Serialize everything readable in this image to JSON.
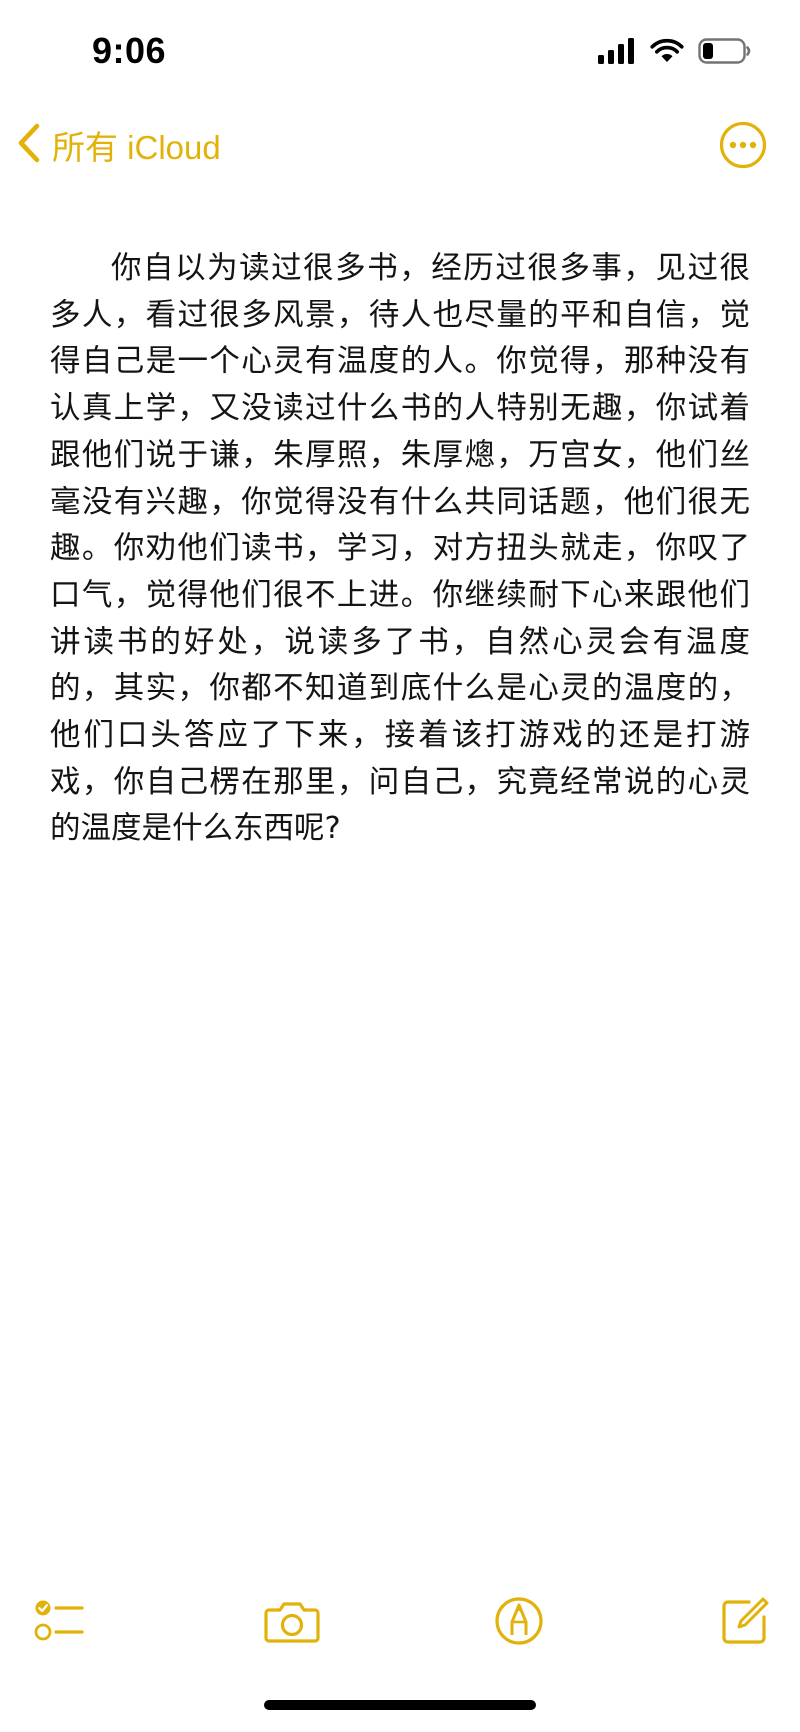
{
  "status_bar": {
    "time": "9:06",
    "icons": [
      "cellular-signal-icon",
      "wifi-icon",
      "battery-icon"
    ],
    "battery_level": 0.25
  },
  "nav": {
    "back_label": "所有 iCloud",
    "back_icon": "chevron-left-icon",
    "more_icon": "ellipsis-circle-icon"
  },
  "note": {
    "text": "你自以为读过很多书，经历过很多事，见过很多人，看过很多风景，待人也尽量的平和自信，觉得自己是一个心灵有温度的人。你觉得，那种没有认真上学，又没读过什么书的人特别无趣，你试着跟他们说于谦，朱厚照，朱厚熜，万宫女，他们丝毫没有兴趣，你觉得没有什么共同话题，他们很无趣。你劝他们读书，学习，对方扭头就走，你叹了口气，觉得他们很不上进。你继续耐下心来跟他们讲读书的好处，说读多了书，自然心灵会有温度的，其实，你都不知道到底什么是心灵的温度的，他们口头答应了下来，接着该打游戏的还是打游戏，你自己楞在那里，问自己，究竟经常说的心灵的温度是什么东西呢?"
  },
  "toolbar": {
    "items": [
      {
        "icon": "checklist-icon"
      },
      {
        "icon": "camera-icon"
      },
      {
        "icon": "markup-pen-icon"
      },
      {
        "icon": "compose-icon"
      }
    ]
  },
  "colors": {
    "accent": "#E2B20B",
    "text": "#141414",
    "background": "#FFFFFF"
  }
}
